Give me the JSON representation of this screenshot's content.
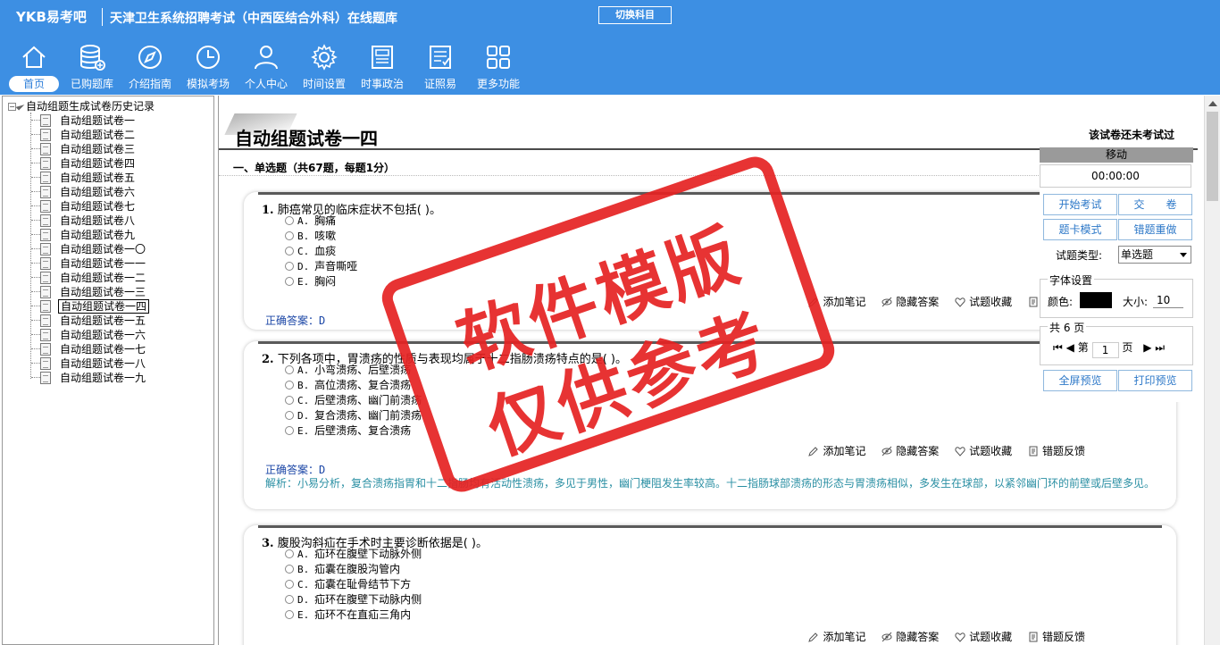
{
  "header": {
    "brand": "YKB易考吧",
    "title": "天津卫生系统招聘考试（中西医结合外科）在线题库",
    "switch_subject": "切换科目"
  },
  "nav": [
    {
      "label": "首页",
      "icon": "home-icon"
    },
    {
      "label": "已购题库",
      "icon": "database-icon"
    },
    {
      "label": "介绍指南",
      "icon": "compass-icon"
    },
    {
      "label": "模拟考场",
      "icon": "clock-icon"
    },
    {
      "label": "个人中心",
      "icon": "user-icon"
    },
    {
      "label": "时间设置",
      "icon": "gear-icon"
    },
    {
      "label": "时事政治",
      "icon": "newspaper-icon"
    },
    {
      "label": "证照易",
      "icon": "certificate-icon"
    },
    {
      "label": "更多功能",
      "icon": "grid-icon"
    }
  ],
  "tree": {
    "root": "自动组题生成试卷历史记录",
    "items": [
      "自动组题试卷一",
      "自动组题试卷二",
      "自动组题试卷三",
      "自动组题试卷四",
      "自动组题试卷五",
      "自动组题试卷六",
      "自动组题试卷七",
      "自动组题试卷八",
      "自动组题试卷九",
      "自动组题试卷一〇",
      "自动组题试卷一一",
      "自动组题试卷一二",
      "自动组题试卷一三",
      "自动组题试卷一四",
      "自动组题试卷一五",
      "自动组题试卷一六",
      "自动组题试卷一七",
      "自动组题试卷一八",
      "自动组题试卷一九"
    ],
    "selected_index": 13
  },
  "paper": {
    "title": "自动组题试卷一四",
    "status": "该试卷还未考试过",
    "section": "一、单选题（共67题，每题1分）"
  },
  "actions": {
    "note": "添加笔记",
    "hide": "隐藏答案",
    "fav": "试题收藏",
    "report": "错题反馈"
  },
  "answer_label": "正确答案：",
  "explain_label": "解析：",
  "questions": [
    {
      "num": "1.",
      "text": "肺癌常见的临床症状不包括(  )。",
      "options": [
        [
          "A.",
          "胸痛"
        ],
        [
          "B.",
          "咳嗽"
        ],
        [
          "C.",
          "血痰"
        ],
        [
          "D.",
          "声音嘶哑"
        ],
        [
          "E.",
          "胸闷"
        ]
      ],
      "answer": "D",
      "explain": ""
    },
    {
      "num": "2.",
      "text": "下列各项中，胃溃疡的性质与表现均属于十二指肠溃疡特点的是(  )。",
      "options": [
        [
          "A.",
          "小弯溃疡、后壁溃疡"
        ],
        [
          "B.",
          "高位溃疡、复合溃疡"
        ],
        [
          "C.",
          "后壁溃疡、幽门前溃疡"
        ],
        [
          "D.",
          "复合溃疡、幽门前溃疡"
        ],
        [
          "E.",
          "后壁溃疡、复合溃疡"
        ]
      ],
      "answer": "D",
      "explain": "小易分析，复合溃疡指胃和十二指肠均有活动性溃疡，多见于男性，幽门梗阻发生率较高。十二指肠球部溃疡的形态与胃溃疡相似，多发生在球部，以紧邻幽门环的前壁或后壁多见。"
    },
    {
      "num": "3.",
      "text": "腹股沟斜疝在手术时主要诊断依据是(  )。",
      "options": [
        [
          "A.",
          "疝环在腹壁下动脉外侧"
        ],
        [
          "B.",
          "疝囊在腹股沟管内"
        ],
        [
          "C.",
          "疝囊在耻骨结节下方"
        ],
        [
          "D.",
          "疝环在腹壁下动脉内侧"
        ],
        [
          "E.",
          "疝环不在直疝三角内"
        ]
      ],
      "answer": "",
      "explain": ""
    }
  ],
  "panel": {
    "move": "移动",
    "timer": "00:00:00",
    "start": "开始考试",
    "submit": "交　　卷",
    "card_mode": "题卡模式",
    "redo_wrong": "错题重做",
    "qtype_label": "试题类型:",
    "qtype_value": "单选题",
    "font_legend": "字体设置",
    "color_label": "颜色:",
    "size_label": "大小:",
    "size_value": "10",
    "pages_legend": "共 6 页",
    "page_prefix": "第",
    "page_value": "1",
    "page_suffix": "页",
    "fullscreen": "全屏预览",
    "print": "打印预览"
  },
  "watermark": {
    "line1": "软件模版",
    "line2": "仅供参考"
  },
  "colors": {
    "header_bg": "#3d8fe3",
    "answer": "#1b46a6",
    "explain": "#2a8fa3",
    "stamp": "#e52222",
    "button_text": "#2d78c8"
  }
}
